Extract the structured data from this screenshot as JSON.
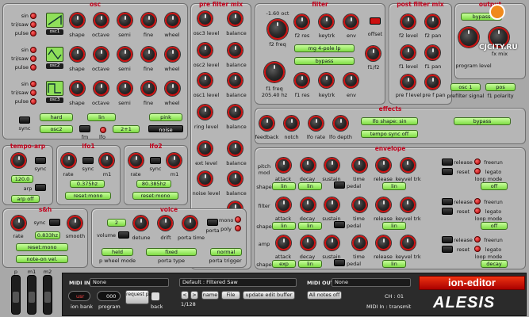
{
  "osc": {
    "title": "osc",
    "wave_labels": [
      "sin",
      "tri/saw",
      "pulse"
    ],
    "osc_names": [
      "osc1",
      "osc2",
      "osc3"
    ],
    "knobs": [
      "shape",
      "octave",
      "semi",
      "fine",
      "wheel"
    ],
    "sync": {
      "label": "sync",
      "mode": "hard",
      "target": "osc2"
    },
    "lin": "lin",
    "fm": "fm",
    "lfo_label": "lfo",
    "lfo_val": "2+1",
    "pink": "pink",
    "noise": "noise"
  },
  "prefilter": {
    "title": "pre filter mix",
    "rows": [
      [
        "osc3 level",
        "balance"
      ],
      [
        "osc2 level",
        "balance"
      ],
      [
        "osc1 level",
        "balance"
      ],
      [
        "ring level",
        "balance"
      ],
      [
        "ext level",
        "balance"
      ],
      [
        "noise level",
        "balance"
      ]
    ]
  },
  "filter": {
    "title": "filter",
    "oct": "-1.60 oct",
    "f2_freq": "f2 freq",
    "f2_knobs": [
      "f2 res",
      "keytrk",
      "env"
    ],
    "offset": "offset",
    "mode": "mg 4-pole lp",
    "bypass": "bypass",
    "f1_freq": "f1 freq",
    "f1_val": "205.40 hz",
    "f1_knobs": [
      "f1 res",
      "keytrk",
      "env"
    ],
    "f1f2": "f1/f2"
  },
  "postfilter": {
    "title": "post filter mix",
    "k1": [
      "f2 level",
      "f2 pan"
    ],
    "k2": [
      "f1 level",
      "f1 pan"
    ],
    "k3": [
      "pre f level",
      "pre f pan"
    ],
    "prefilter_signal": "prefilter signal",
    "osc1": "osc 1",
    "f1polarity": "f1 polarity",
    "pos": "pos"
  },
  "output": {
    "title": "output",
    "bypass": "bypass",
    "program_level": "program level",
    "fx_mix": "fx mix",
    "watermark": "CJCITY.RU"
  },
  "effects": {
    "title": "effects",
    "knobs": [
      "feedback",
      "notch",
      "lfo rate",
      "lfo depth"
    ],
    "lfo_shape": "lfo shape: sin",
    "tempo_sync": "tempo sync off",
    "bypass": "bypass"
  },
  "tempo": {
    "title": "tempo-arp",
    "sync": "sync",
    "bpm": "120.0",
    "arp": "arp",
    "arp_val": "arp off"
  },
  "lfo1": {
    "title": "lfo1",
    "rate": "rate",
    "sync": "sync",
    "m1": "m1",
    "val": "0.375hz",
    "mode": "reset:mono"
  },
  "lfo2": {
    "title": "lfo2",
    "rate": "rate",
    "sync": "sync",
    "m1": "m1",
    "val": "80.385hz",
    "mode": "reset:mono"
  },
  "sh": {
    "title": "s&h",
    "rate": "rate",
    "sync": "sync",
    "smooth": "smooth",
    "val": "0.833hz",
    "mode": "reset:mono",
    "trigger": "note-on vel."
  },
  "voice": {
    "title": "voice",
    "count": "2",
    "volume": "volume",
    "knobs": [
      "detune",
      "drift",
      "porta time"
    ],
    "porta": "porta",
    "mono": "mono",
    "poly": "poly",
    "wheel_mode": "p wheel mode",
    "held": "held",
    "porta_type": "porta type",
    "fixed": "fixed",
    "porta_trigger": "porta trigger",
    "normal": "normal"
  },
  "envelope": {
    "title": "envelope",
    "pitch_mod": "pitch mod",
    "filter": "filter",
    "amp": "amp",
    "shape": "shape",
    "knobs": [
      "attack",
      "decay",
      "sustain",
      "time",
      "release",
      "keyvel trk"
    ],
    "pedal": "pedal",
    "lin": "lin",
    "exp": "exp",
    "release": "release",
    "reset": "reset",
    "freerun": "freerun",
    "legato": "legato",
    "loop_mode": "loop mode",
    "off": "off",
    "decay": "decay"
  },
  "mod_sliders": [
    "p",
    "m1",
    "m2"
  ],
  "bottom": {
    "midi_in_label": "MIDI IN:",
    "midi_in": "None",
    "preset": "Default : Filtered Saw",
    "midi_out_label": "MIDI OUT:",
    "midi_out": "None",
    "ion_bank": "ion bank",
    "bank_val": "usr",
    "program": "program",
    "program_val": "000",
    "request_patch": "request patch",
    "back": "back",
    "count": "1/128",
    "name": "name",
    "file": "File",
    "update": "update edit buffer",
    "all_notes_off": "All notes off",
    "ch": "CH : 01",
    "midi_transmit": "MIDI In : transmit",
    "app_name": "ion-editor",
    "brand": "ALESIS"
  },
  "colors": {
    "accent": "#c2001b",
    "lcd": "#8fe05a",
    "panel": "#b6b6b6"
  }
}
